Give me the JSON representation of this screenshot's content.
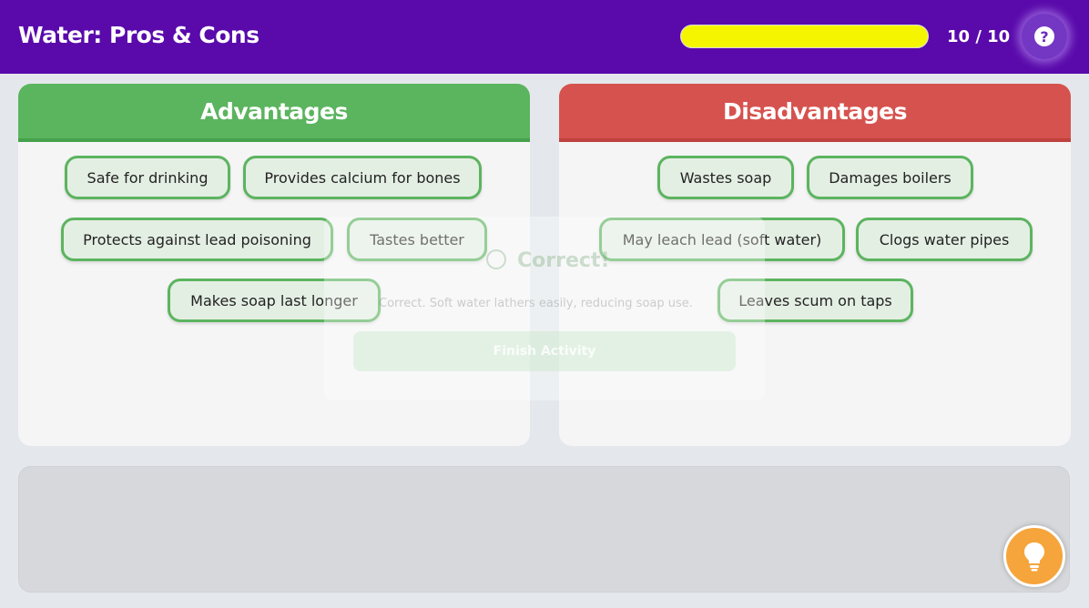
{
  "header": {
    "title": "Water: Pros & Cons",
    "progress_fraction": 1.0,
    "progress_text": "10 / 10",
    "help_symbol": "?",
    "help_icon": "question-circle-icon",
    "colors": {
      "bar": "#5a0aab",
      "progress_fill": "#f5f500"
    }
  },
  "advantages": {
    "title": "Advantages",
    "color": "#5bb45e",
    "items": [
      "Safe for drinking",
      "Provides calcium for bones",
      "Protects against lead poisoning",
      "Tastes better",
      "Makes soap last longer"
    ]
  },
  "disadvantages": {
    "title": "Disadvantages",
    "color": "#d6524e",
    "items": [
      "Wastes soap",
      "Damages boilers",
      "May leach lead (soft water)",
      "Clogs water pipes",
      "Leaves scum on taps"
    ]
  },
  "feedback": {
    "title": "Correct!",
    "message": "Correct. Soft water lathers easily, reducing soap use.",
    "button_label": "Finish Activity",
    "icon": "check-circle-icon"
  },
  "hint": {
    "icon": "lightbulb-icon",
    "color": "#f5a53c"
  }
}
